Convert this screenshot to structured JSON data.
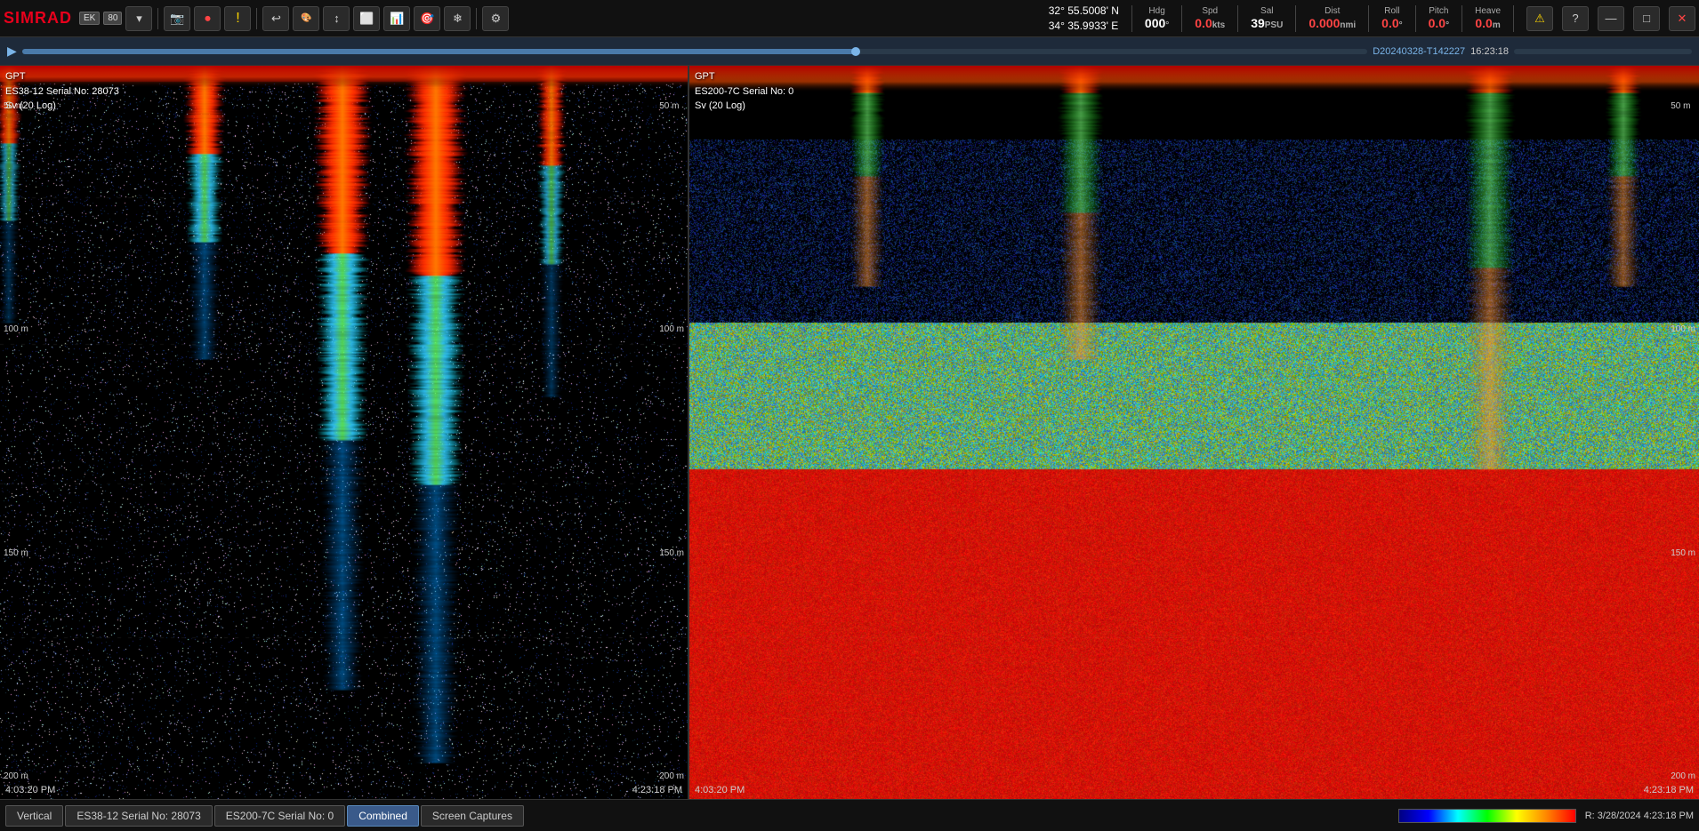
{
  "topbar": {
    "logo": "SIMRAD",
    "badges": [
      "EK",
      "80"
    ],
    "buttons": [
      "▾",
      "📷",
      "⏺",
      "!",
      "↩",
      "🎨",
      "↕",
      "⬜",
      "📊",
      "🎯",
      "❄",
      "⚙"
    ],
    "coordinates": {
      "lat": "32° 55.5008' N",
      "lon": "34° 35.9933' E"
    },
    "nav_items": [
      {
        "label": "Hdg",
        "value": "000",
        "unit": "°"
      },
      {
        "label": "Spd",
        "value": "0.0",
        "unit": "kts"
      },
      {
        "label": "Sal",
        "value": "39",
        "unit": "PSU"
      },
      {
        "label": "Dist",
        "value": "0.000",
        "unit": "nmi"
      },
      {
        "label": "Roll",
        "value": "0.0",
        "unit": "°"
      },
      {
        "label": "Pitch",
        "value": "0.0",
        "unit": "°"
      },
      {
        "label": "Heave",
        "value": "0.0",
        "unit": "m"
      }
    ]
  },
  "playback": {
    "filename": "D20240328-T142227",
    "time": "16:23:18",
    "progress_pct": 62
  },
  "left_panel": {
    "gpt_label": "GPT",
    "serial_info": "ES38-12 Serial No: 28073",
    "sv_label": "Sv (20 Log)",
    "ts_start": "4:03:20 PM",
    "ts_end": "4:23:18 PM",
    "depth_markers": [
      "50 m",
      "100 m",
      "150 m",
      "200 m"
    ]
  },
  "right_panel": {
    "gpt_label": "GPT",
    "serial_info": "ES200-7C Serial No: 0",
    "sv_label": "Sv (20 Log)",
    "ts_start": "4:03:20 PM",
    "ts_end": "4:23:18 PM",
    "depth_markers": [
      "50 m",
      "100 m",
      "150 m",
      "200 m"
    ]
  },
  "bottom_tabs": [
    "Vertical",
    "ES38-12 Serial No: 28073",
    "ES200-7C Serial No: 0",
    "Combined",
    "Screen Captures"
  ],
  "bottom": {
    "active_tab": "Combined",
    "date_info": "R: 3/28/2024   4:23:18 PM"
  }
}
